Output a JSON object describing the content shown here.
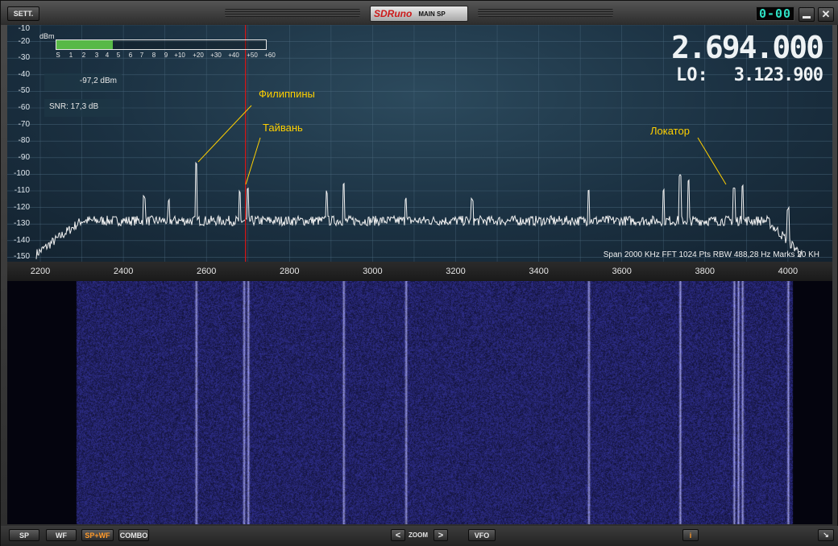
{
  "titlebar": {
    "sett_label": "SETT.",
    "brand": "SDRuno",
    "title": "MAIN SP",
    "clock": "0-00",
    "minimize_icon": "minimize-icon",
    "close_label": "✕"
  },
  "spectrum": {
    "unit_label": "dBm",
    "y_ticks": [
      "-10",
      "-20",
      "-30",
      "-40",
      "-50",
      "-60",
      "-70",
      "-80",
      "-90",
      "-100",
      "-110",
      "-120",
      "-130",
      "-140",
      "-150"
    ],
    "x_ticks": [
      "2200",
      "2400",
      "2600",
      "2800",
      "3000",
      "3200",
      "3400",
      "3600",
      "3800",
      "4000"
    ],
    "smeter_ticks": [
      "S",
      "1",
      "2",
      "3",
      "4",
      "5",
      "6",
      "7",
      "8",
      "9",
      "+10",
      "+20",
      "+30",
      "+40",
      "+50",
      "+60"
    ],
    "smeter_level_fraction": 0.27,
    "level": "-97,2 dBm",
    "snr": "SNR: 17,3 dB",
    "frequency": "2.694.000",
    "lo_label": "LO:",
    "lo_value": "3.123.900",
    "status_line": "Span 2000 KHz   FFT 1024 Pts   RBW 488,28 Hz   Marks 20 KH",
    "tuned_freq_khz": 2694,
    "annotations": {
      "philippines": "Филиппины",
      "taiwan": "Тайвань",
      "locator": "Локатор"
    },
    "colors": {
      "trace": "#f2f2f2",
      "tuning_line": "#d01818",
      "annotation": "#ffd000",
      "grid": "#4d6b80"
    }
  },
  "waterfall": {
    "background_color": "#2a2a8a"
  },
  "bottombar": {
    "sp": "SP",
    "wf": "WF",
    "spwf": "SP+WF",
    "combo": "COMBO",
    "zoom_left": "<",
    "zoom": "ZOOM",
    "zoom_right": ">",
    "vfo": "VFO",
    "info": "i",
    "expand": "↘"
  }
}
